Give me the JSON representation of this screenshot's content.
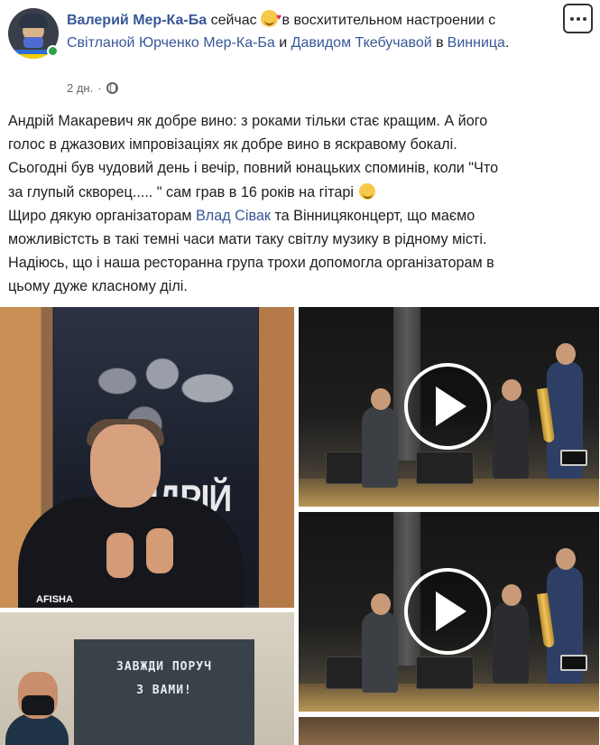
{
  "post": {
    "author": "Валерий Мер-Ка-Ба",
    "when_now": "сейчас",
    "feeling": "в восхитительном настроении",
    "with_word": "с",
    "tagged_1": "Світланой Юрченко Мер-Ка-Ба",
    "and_word": "и",
    "tagged_2": "Давидом Ткебучавой",
    "in_word": "в",
    "location": "Винница",
    "period": ".",
    "timestamp": "2 дн.",
    "separator": "·",
    "privacy_icon": "globe-icon",
    "more_icon": "more-options-icon"
  },
  "text": {
    "line1": "Андрій Макаревич як добре вино: з роками тільки стає кращим. А його",
    "line2": "голос в джазових імпровізаціях як добре вино в яскравому бокалі.",
    "line3": "Сьогодні був чудовий день і вечір, повний юнацьких споминів, коли \"Что",
    "line4": "за глупый скворец..... \" сам грав в 16 років на гітарі",
    "line5_a": "Щиро дякую організаторам",
    "line5_link": "Влад Сівак",
    "line5_b": "та Вінницяконцерт, що маємо",
    "line6": "можливістсть в такі темні часи мати таку світлу музику в рідному місті.",
    "line7": "Надіюсь, що і наша ресторанна група трохи допомогла організаторам в",
    "line8": "цьому дуже класному ділі."
  },
  "photos": {
    "poster_text": "НДРІЙ ВИЧ",
    "poster_brand": "AFISHA",
    "banner_line1": "ЗАВЖДИ ПОРУЧ",
    "banner_line2": "З ВАМИ!",
    "video_play_icon": "play-icon"
  },
  "colors": {
    "link": "#385898",
    "text": "#1c1e21",
    "meta": "#606770",
    "online": "#31a24c"
  }
}
